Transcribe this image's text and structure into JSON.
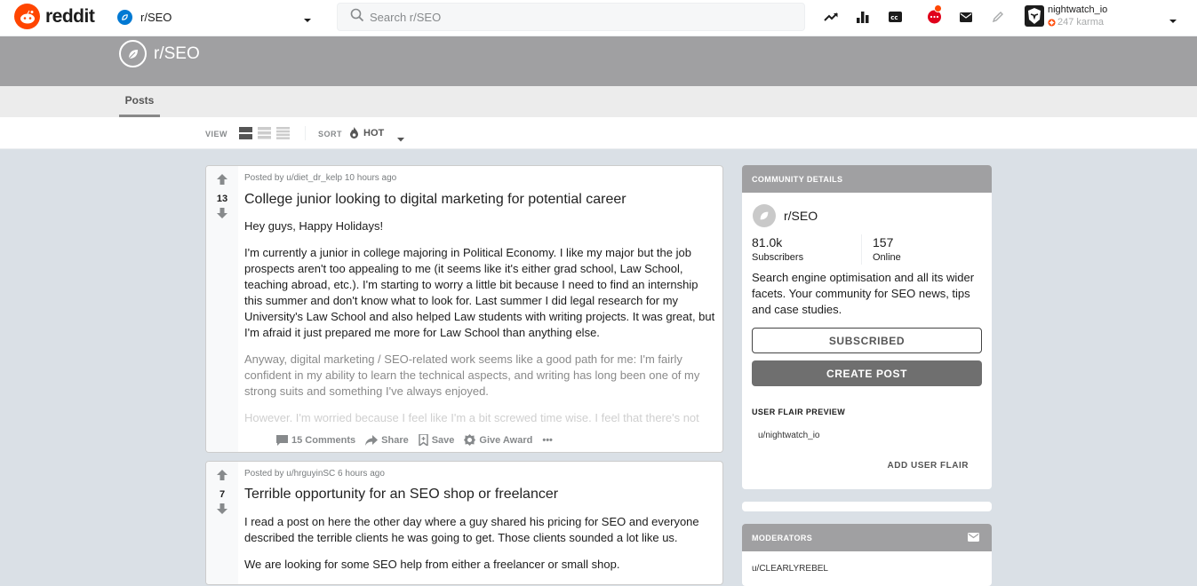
{
  "header": {
    "logo_text": "reddit",
    "community": "r/SEO",
    "search_placeholder": "Search r/SEO",
    "icons": [
      "trending-icon",
      "stats-icon",
      "closed-caption-icon",
      "chat-icon",
      "mail-icon",
      "pencil-icon"
    ],
    "user": {
      "name": "nightwatch_io",
      "karma": "247 karma"
    }
  },
  "banner": {
    "title": "r/SEO"
  },
  "tabs": {
    "posts": "Posts"
  },
  "viewbar": {
    "view_label": "VIEW",
    "sort_label": "SORT",
    "sort_value": "HOT"
  },
  "posts": [
    {
      "meta": "Posted by u/diet_dr_kelp 10 hours ago",
      "votes": "13",
      "title": "College junior looking to digital marketing for potential career",
      "body": [
        "Hey guys, Happy Holidays!",
        "I'm currently a junior in college majoring in Political Economy. I like my major but the job prospects aren't too appealing to me (it seems like it's either grad school, Law School, teaching abroad, etc.). I'm starting to worry a little bit because I need to find an internship this summer and don't know what to look for. Last summer I did legal research for my University's Law School and also helped Law students with writing projects. It was great, but I'm afraid it just prepared me more for Law School than anything else.",
        "Anyway, digital marketing / SEO-related work seems like a good path for me: I'm fairly confident in my ability to learn the technical aspects, and writing has long been one of my strong suits and something I've always enjoyed.",
        "However, I'm worried because I feel like I'm a bit screwed time wise. I feel that there's not"
      ],
      "actions": {
        "comments": "15 Comments",
        "share": "Share",
        "save": "Save",
        "award": "Give Award",
        "more": "•••"
      }
    },
    {
      "meta": "Posted by u/hrguyinSC 6 hours ago",
      "votes": "7",
      "title": "Terrible opportunity for an SEO shop or freelancer",
      "body": [
        "I read a post on here the other day where a guy shared his pricing for SEO and everyone described the terrible clients he was going to get. Those clients sounded a lot like us.",
        "We are looking for some SEO help from either a freelancer or small shop."
      ]
    }
  ],
  "sidebar": {
    "community_details": {
      "header": "COMMUNITY DETAILS",
      "name": "r/SEO",
      "subscribers_value": "81.0k",
      "subscribers_label": "Subscribers",
      "online_value": "157",
      "online_label": "Online",
      "description": "Search engine optimisation and all its wider facets. Your community for SEO news, tips and case studies.",
      "subscribed_button": "SUBSCRIBED",
      "create_post_button": "CREATE POST",
      "flair_title": "USER FLAIR PREVIEW",
      "flair_user": "u/nightwatch_io",
      "add_flair": "ADD USER FLAIR"
    },
    "moderators": {
      "header": "MODERATORS",
      "first": "u/CLEARLYREBEL"
    }
  },
  "colors": {
    "brand": "#ff4500",
    "banner": "#a0a0a2",
    "page_bg": "#dae0e6",
    "button_dark": "#6f6f6f"
  }
}
